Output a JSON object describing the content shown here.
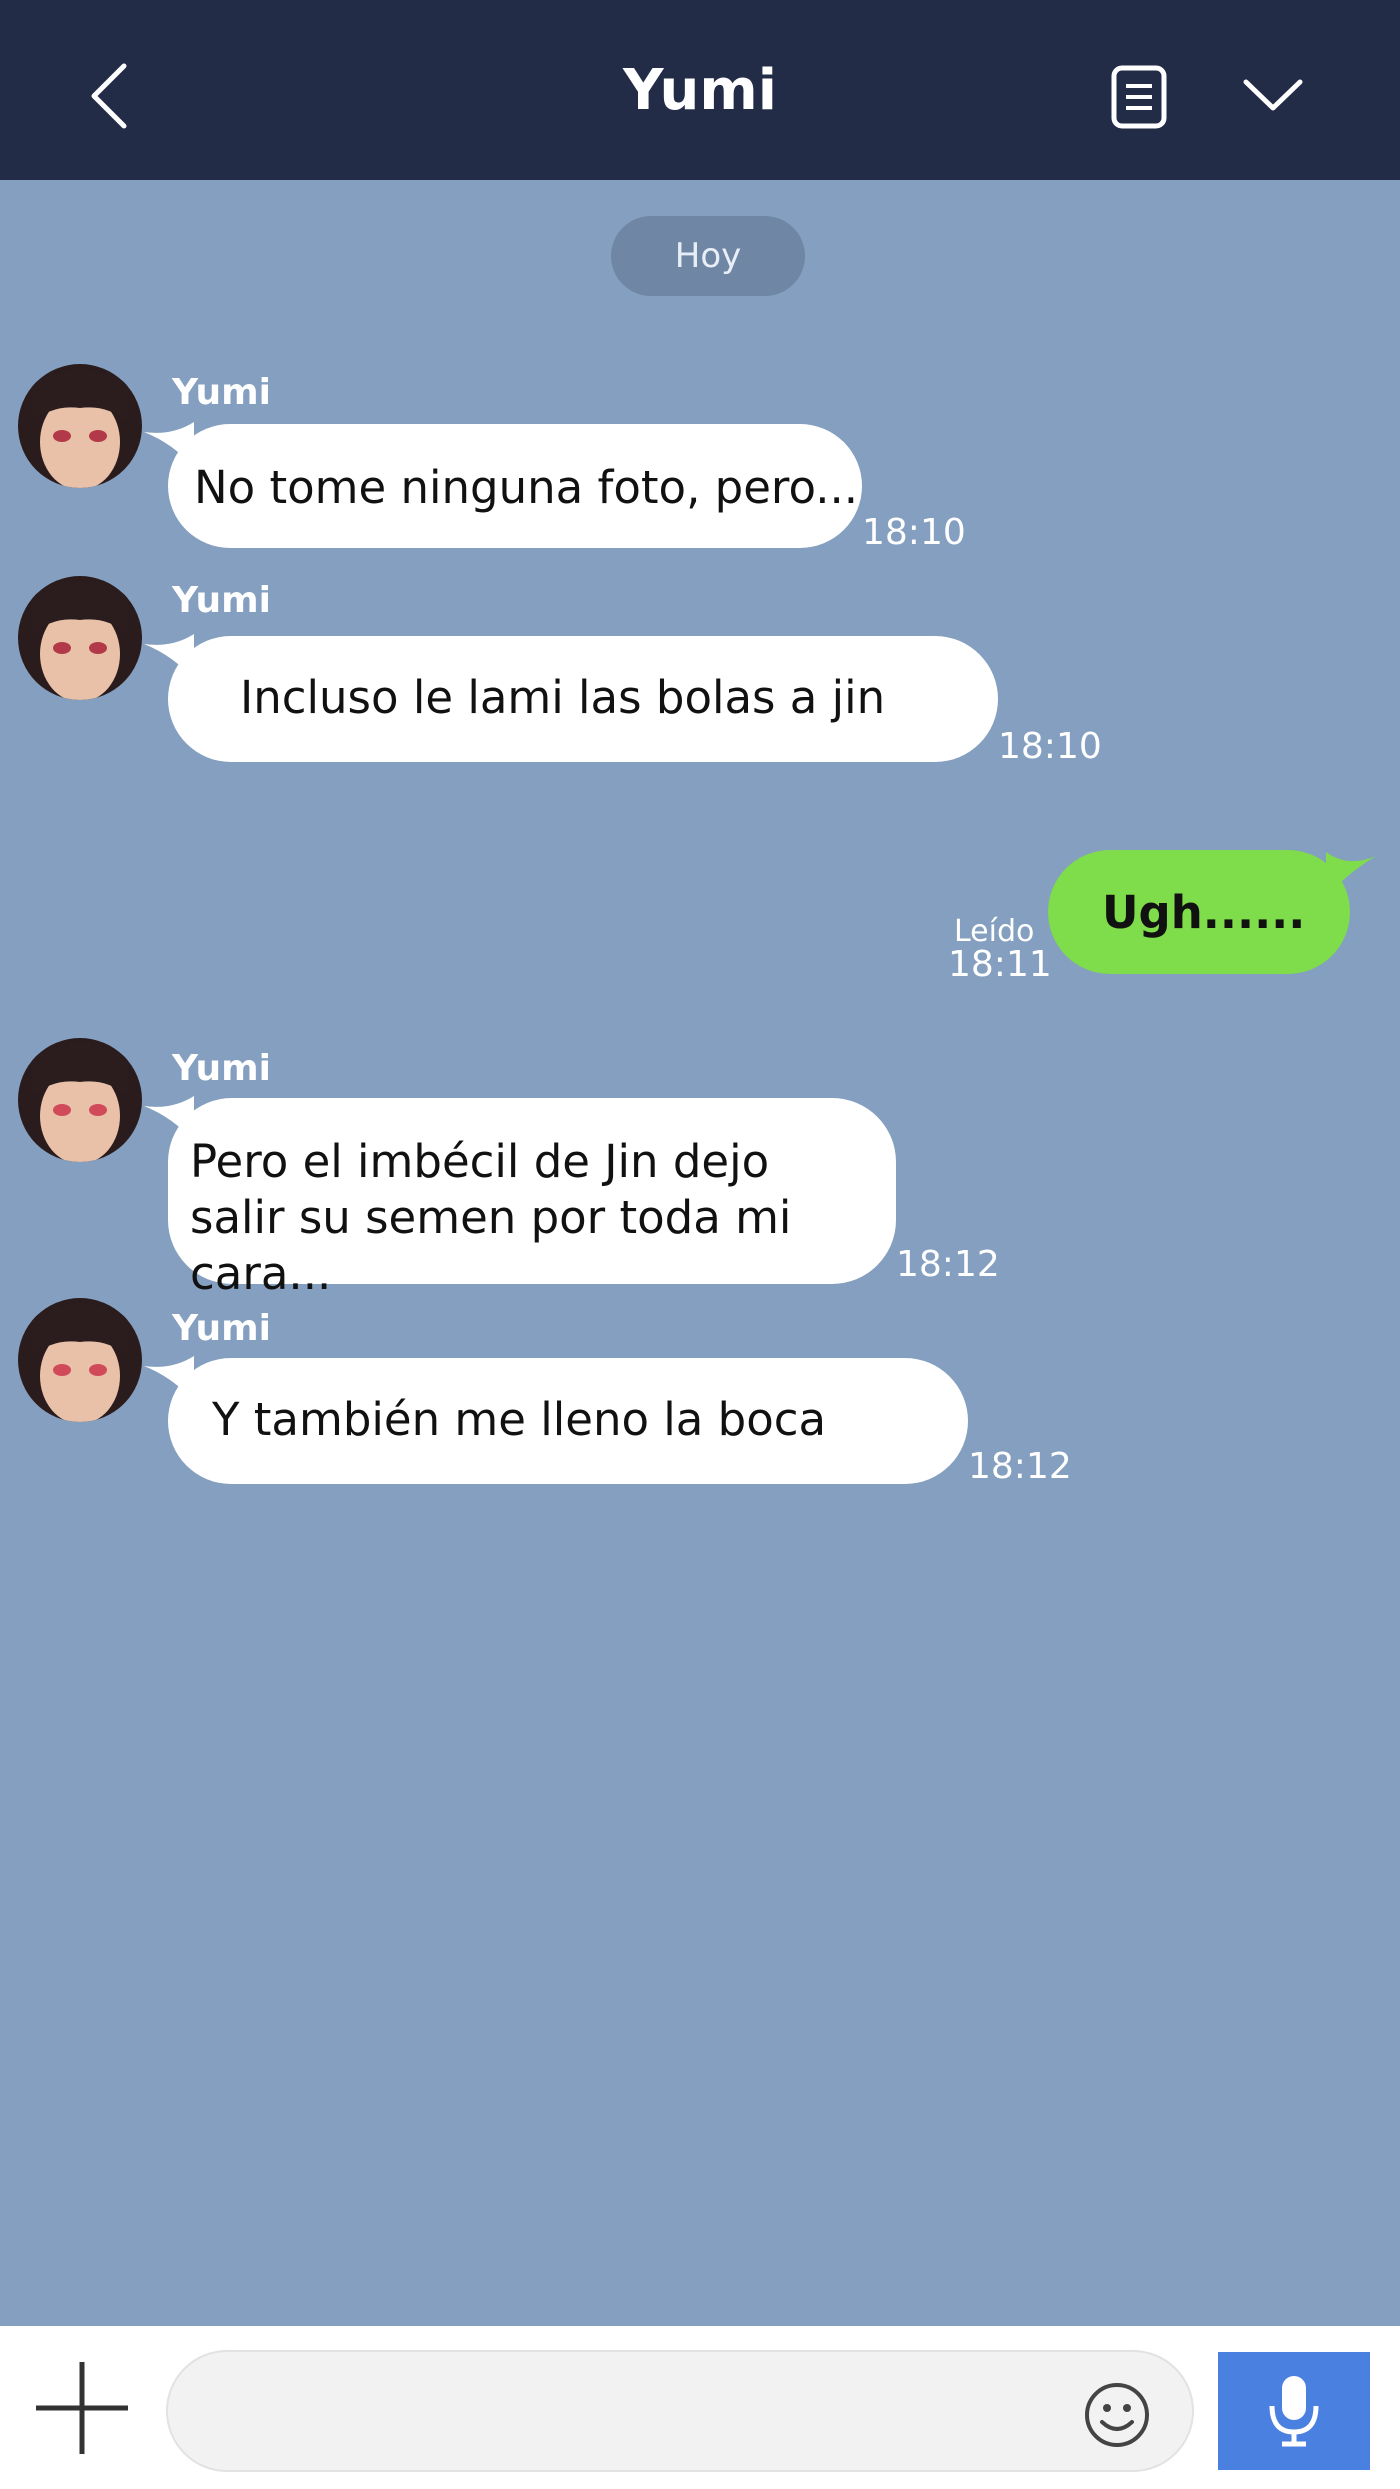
{
  "header": {
    "title": "Yumi",
    "back_icon": "chevron-left-icon",
    "notes_icon": "notes-icon",
    "menu_icon": "chevron-down-icon"
  },
  "date_label": "Hoy",
  "messages": [
    {
      "sender": "Yumi",
      "text": "No tome ninguna foto, pero...",
      "time": "18:10"
    },
    {
      "sender": "Yumi",
      "text": "Incluso le lami las bolas a jin",
      "time": "18:10"
    },
    {
      "sender": "",
      "text": "Ugh......",
      "time": "18:11",
      "status": "Leído"
    },
    {
      "sender": "Yumi",
      "text": "Pero el imbécil de Jin dejo salir su semen por toda mi cara...",
      "time": "18:12"
    },
    {
      "sender": "Yumi",
      "text": "Y también me lleno la boca",
      "time": "18:12"
    }
  ],
  "input": {
    "placeholder": "",
    "plus_icon": "plus-icon",
    "emoji_icon": "emoji-icon",
    "mic_icon": "microphone-icon"
  },
  "colors": {
    "header_bg": "#232c47",
    "chat_bg": "#849fbf",
    "incoming_bubble": "#ffffff",
    "outgoing_bubble": "#7fdc4a",
    "mic_button": "#4a80e0"
  }
}
